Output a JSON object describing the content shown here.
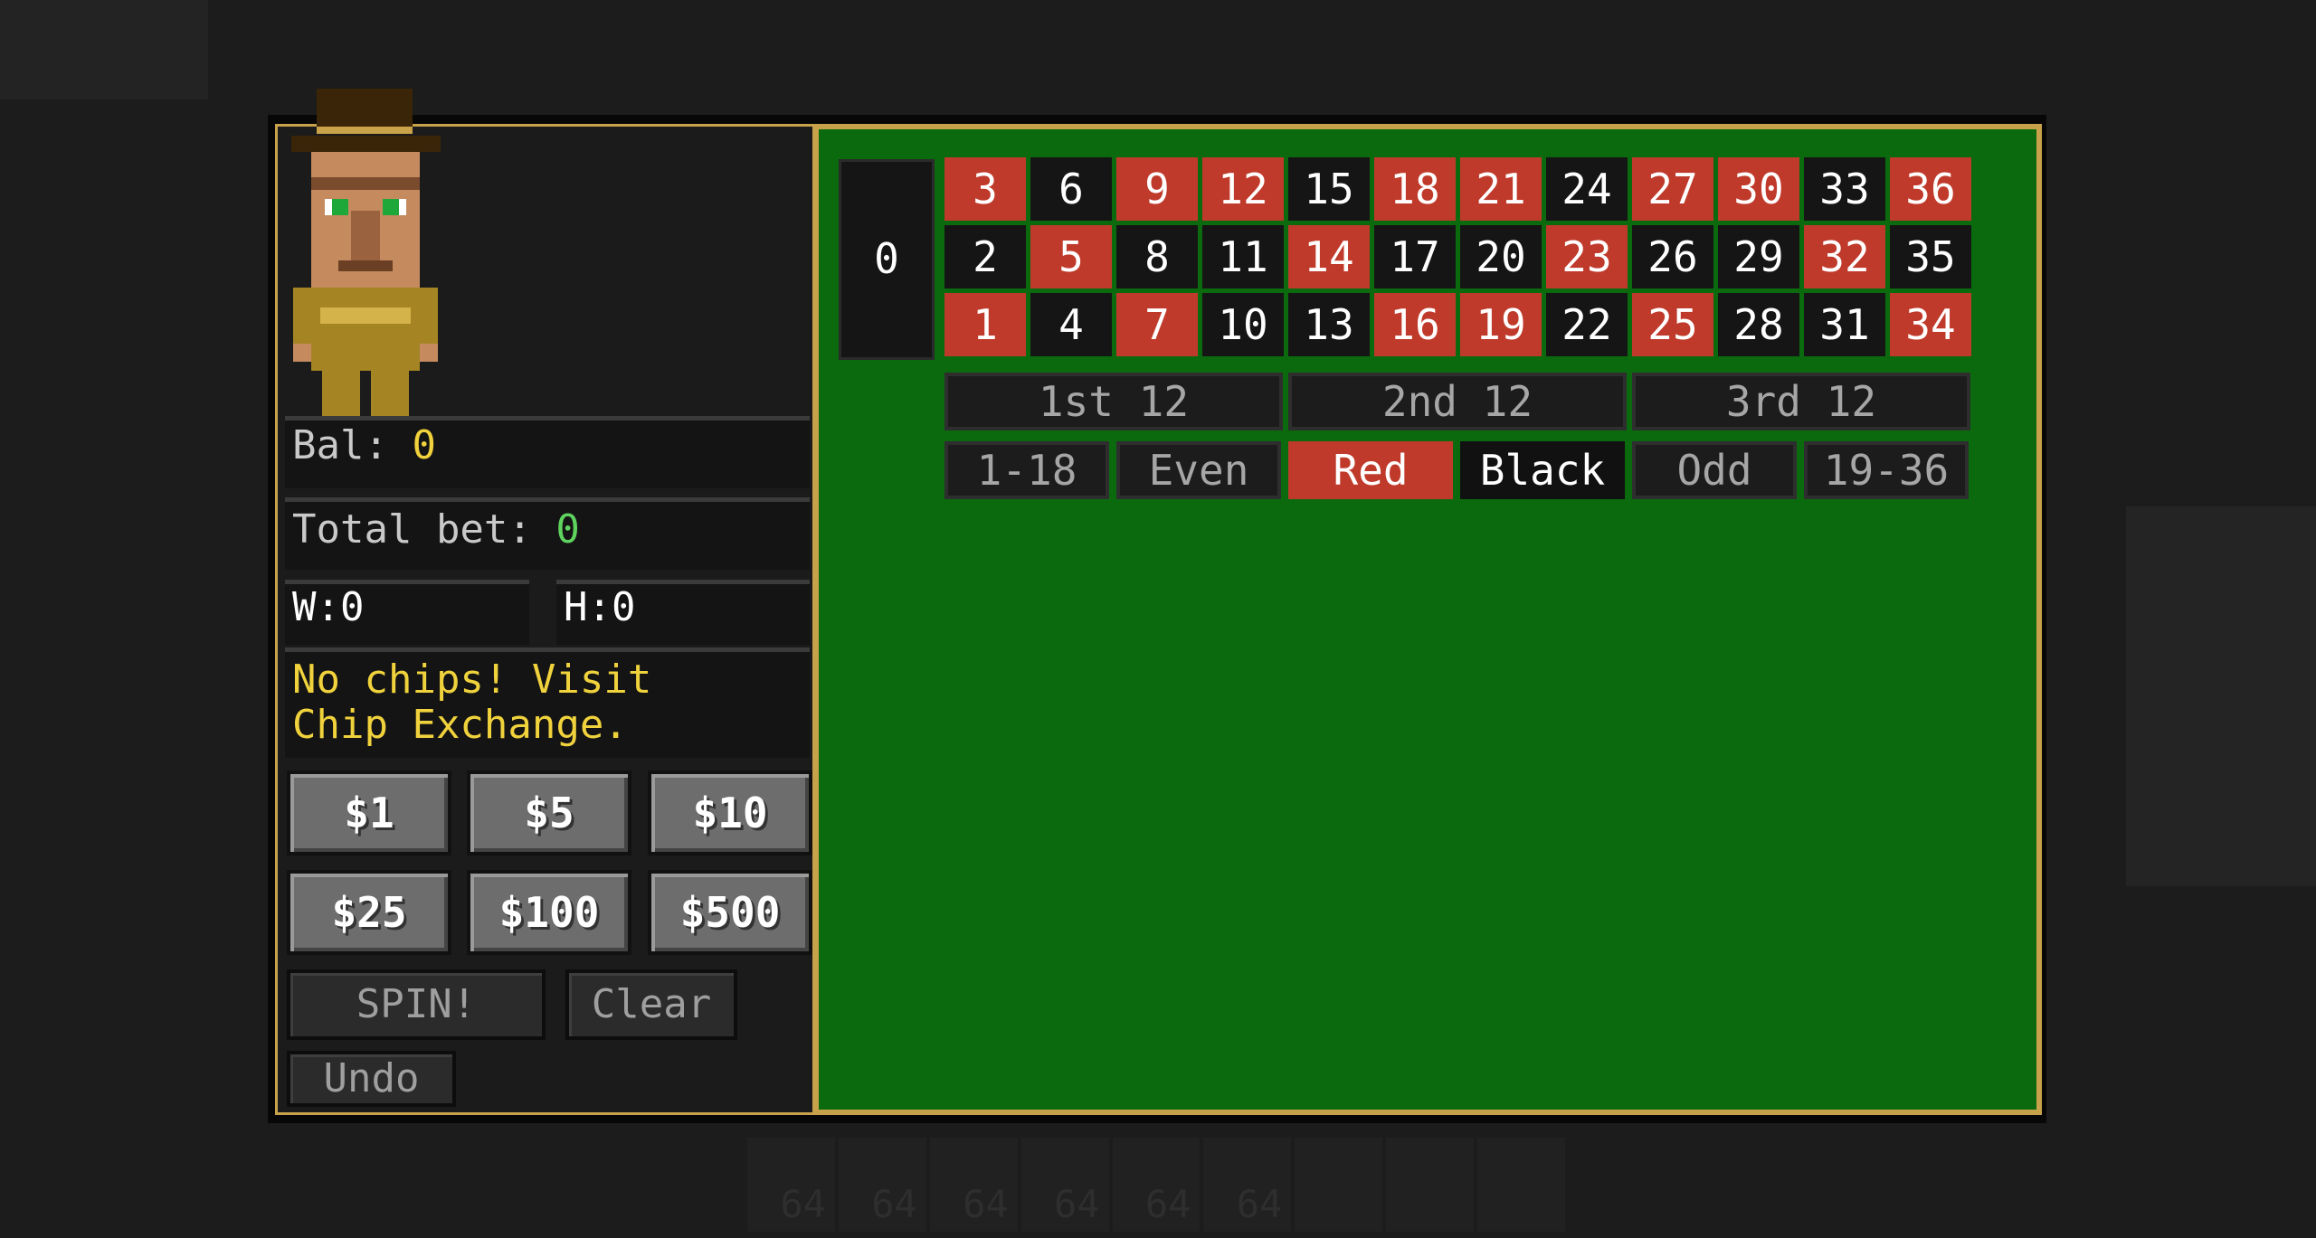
{
  "stats": {
    "balance_label": "Bal:",
    "balance_value": "0",
    "total_bet_label": "Total bet:",
    "total_bet_value": "0",
    "wins": "W:0",
    "hits": "H:0",
    "message_line1": "No chips! Visit",
    "message_line2": "Chip Exchange."
  },
  "chips": [
    "$1",
    "$5",
    "$10",
    "$25",
    "$100",
    "$500"
  ],
  "actions": {
    "spin": "SPIN!",
    "clear": "Clear",
    "undo": "Undo"
  },
  "table": {
    "zero": "0",
    "rows": [
      [
        {
          "n": "3",
          "c": "red"
        },
        {
          "n": "6",
          "c": "black"
        },
        {
          "n": "9",
          "c": "red"
        },
        {
          "n": "12",
          "c": "red"
        },
        {
          "n": "15",
          "c": "black"
        },
        {
          "n": "18",
          "c": "red"
        },
        {
          "n": "21",
          "c": "red"
        },
        {
          "n": "24",
          "c": "black"
        },
        {
          "n": "27",
          "c": "red"
        },
        {
          "n": "30",
          "c": "red"
        },
        {
          "n": "33",
          "c": "black"
        },
        {
          "n": "36",
          "c": "red"
        }
      ],
      [
        {
          "n": "2",
          "c": "black"
        },
        {
          "n": "5",
          "c": "red"
        },
        {
          "n": "8",
          "c": "black"
        },
        {
          "n": "11",
          "c": "black"
        },
        {
          "n": "14",
          "c": "red"
        },
        {
          "n": "17",
          "c": "black"
        },
        {
          "n": "20",
          "c": "black"
        },
        {
          "n": "23",
          "c": "red"
        },
        {
          "n": "26",
          "c": "black"
        },
        {
          "n": "29",
          "c": "black"
        },
        {
          "n": "32",
          "c": "red"
        },
        {
          "n": "35",
          "c": "black"
        }
      ],
      [
        {
          "n": "1",
          "c": "red"
        },
        {
          "n": "4",
          "c": "black"
        },
        {
          "n": "7",
          "c": "red"
        },
        {
          "n": "10",
          "c": "black"
        },
        {
          "n": "13",
          "c": "black"
        },
        {
          "n": "16",
          "c": "red"
        },
        {
          "n": "19",
          "c": "red"
        },
        {
          "n": "22",
          "c": "black"
        },
        {
          "n": "25",
          "c": "red"
        },
        {
          "n": "28",
          "c": "black"
        },
        {
          "n": "31",
          "c": "black"
        },
        {
          "n": "34",
          "c": "red"
        }
      ]
    ],
    "dozens": [
      "1st 12",
      "2nd 12",
      "3rd 12"
    ],
    "even_money": [
      {
        "label": "1-18",
        "style": "plain"
      },
      {
        "label": "Even",
        "style": "plain"
      },
      {
        "label": "Red",
        "style": "red"
      },
      {
        "label": "Black",
        "style": "black"
      },
      {
        "label": "Odd",
        "style": "plain"
      },
      {
        "label": "19-36",
        "style": "plain"
      }
    ]
  },
  "hotbar": {
    "counts": [
      "64",
      "64",
      "64",
      "64",
      "64",
      "64",
      "",
      "",
      ""
    ]
  },
  "colors": {
    "felt": "#0b6a0e",
    "border_gold": "#c8a24a",
    "red": "#c03a2b",
    "black": "#151515"
  }
}
